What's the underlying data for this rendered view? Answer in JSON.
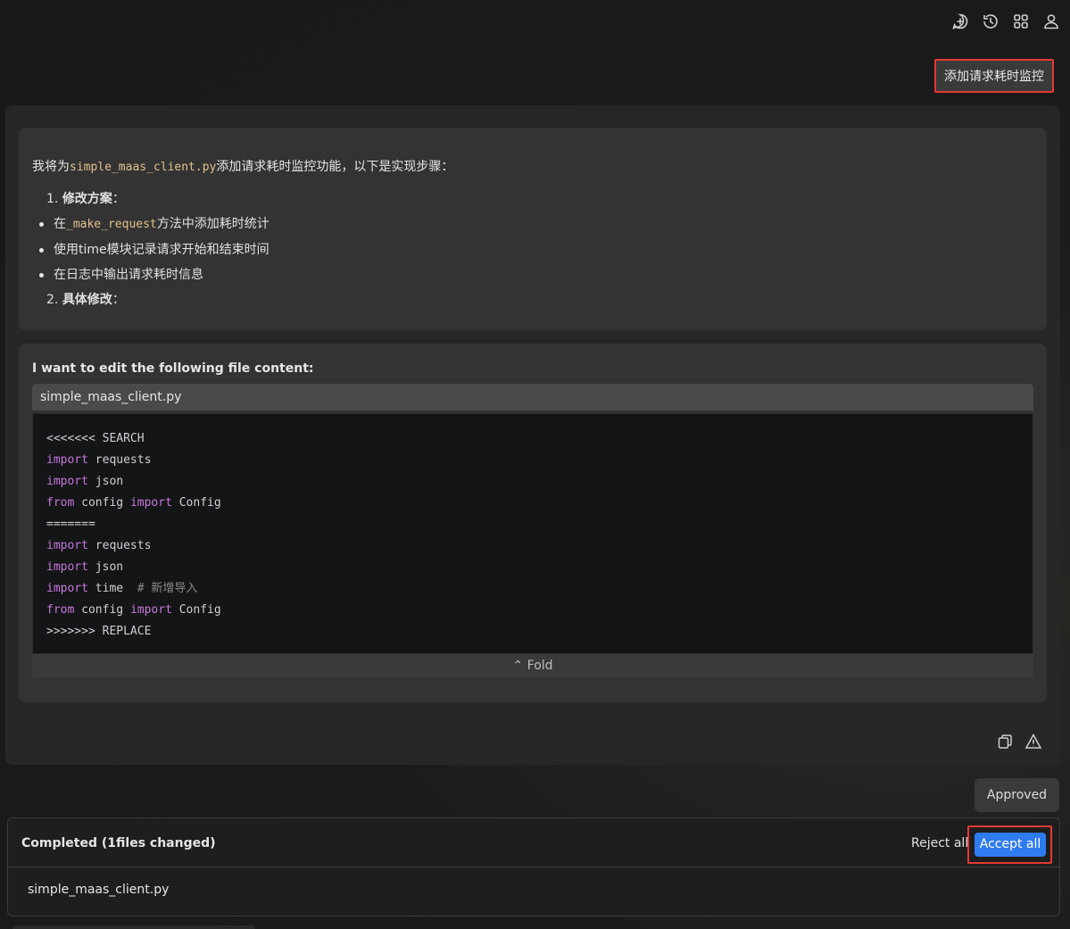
{
  "toolbar": {
    "icons": [
      "new-chat-icon",
      "history-icon",
      "apps-icon",
      "user-icon"
    ]
  },
  "user_message": "添加请求耗时监控",
  "plan": {
    "intro_prefix": "我将为",
    "intro_code": "simple_maas_client.py",
    "intro_suffix": "添加请求耗时监控功能，以下是实现步骤：",
    "step1_num": "1.",
    "step1_label": "修改方案",
    "step1_colon": "：",
    "bullet1_prefix": "在",
    "bullet1_code": "_make_request",
    "bullet1_suffix": "方法中添加耗时统计",
    "bullet2": "使用time模块记录请求开始和结束时间",
    "bullet3": "在日志中输出请求耗时信息",
    "step2_num": "2.",
    "step2_label": "具体修改",
    "step2_colon": "："
  },
  "edit": {
    "title": "I want to edit the following file content:",
    "filename": "simple_maas_client.py",
    "fold_label": "Fold",
    "code": {
      "l1": "<<<<<<< SEARCH",
      "l2_kw": "import",
      "l2_rest": " requests",
      "l3_kw": "import",
      "l3_rest": " json",
      "l4_kw1": "from",
      "l4_mid": " config ",
      "l4_kw2": "import",
      "l4_rest": " Config",
      "l5": "=======",
      "l6_kw": "import",
      "l6_rest": " requests",
      "l7_kw": "import",
      "l7_rest": " json",
      "l8_kw": "import",
      "l8_rest": " time  ",
      "l8_comment": "# 新增导入",
      "l9_kw1": "from",
      "l9_mid": " config ",
      "l9_kw2": "import",
      "l9_rest": " Config",
      "l10": ">>>>>>> REPLACE"
    }
  },
  "card_actions": [
    "copy-icon",
    "warning-icon"
  ],
  "approved_label": "Approved",
  "completed": {
    "title": "Completed  (1files changed)",
    "reject_label": "Reject all",
    "accept_label": "Accept all",
    "file": "simple_maas_client.py"
  },
  "colors": {
    "accent": "#2f7bf0",
    "highlight_border": "#e53935",
    "keyword": "#c678dd",
    "inline_code": "#e2c08d"
  }
}
